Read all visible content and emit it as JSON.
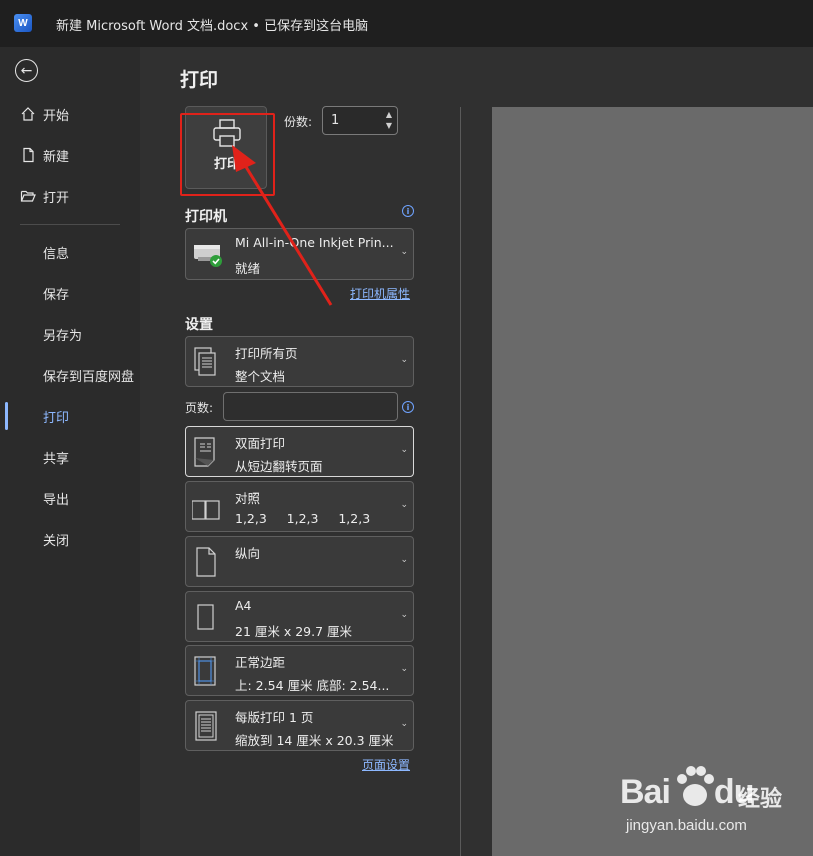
{
  "titlebar": {
    "app_icon": "word-logo-icon",
    "title": "新建 Microsoft Word 文档.docx • 已保存到这台电脑"
  },
  "sidebar": {
    "back_icon": "back-arrow-icon",
    "items": [
      {
        "label": "开始",
        "icon": "home-icon"
      },
      {
        "label": "新建",
        "icon": "new-file-icon"
      },
      {
        "label": "打开",
        "icon": "folder-open-icon"
      },
      {
        "label": "信息"
      },
      {
        "label": "保存"
      },
      {
        "label": "另存为"
      },
      {
        "label": "保存到百度网盘"
      },
      {
        "label": "打印",
        "active": true
      },
      {
        "label": "共享"
      },
      {
        "label": "导出"
      },
      {
        "label": "关闭"
      }
    ]
  },
  "main": {
    "heading": "打印",
    "print_button_label": "打印",
    "copies_label": "份数:",
    "copies_value": "1",
    "printer_section": "打印机",
    "printer": {
      "name": "Mi All-in-One Inkjet Prin...",
      "status": "就绪",
      "properties_link": "打印机属性"
    },
    "settings_section": "设置",
    "settings": [
      {
        "line1": "打印所有页",
        "line2": "整个文档",
        "icon": "pages-icon"
      },
      {
        "line1": "双面打印",
        "line2": "从短边翻转页面",
        "icon": "duplex-icon"
      },
      {
        "line1": "对照",
        "line2": "1,2,3     1,2,3     1,2,3",
        "icon": "collate-icon"
      },
      {
        "line1": "纵向",
        "line2": "",
        "icon": "portrait-icon"
      },
      {
        "line1": "A4",
        "line2": "21 厘米 x 29.7 厘米",
        "icon": "paper-size-icon"
      },
      {
        "line1": "正常边距",
        "line2": "上: 2.54 厘米 底部: 2.54...",
        "icon": "margins-icon"
      },
      {
        "line1": "每版打印 1 页",
        "line2": "缩放到 14 厘米 x 20.3 厘米",
        "icon": "pages-per-sheet-icon"
      }
    ],
    "pages_label": "页数:",
    "pages_value": "",
    "page_setup_link": "页面设置"
  },
  "colors": {
    "accent": "#8db8ff",
    "highlight": "#e0221a"
  },
  "watermark": {
    "brand": "Bai",
    "brand2": "du",
    "product": "经验",
    "url": "jingyan.baidu.com"
  }
}
